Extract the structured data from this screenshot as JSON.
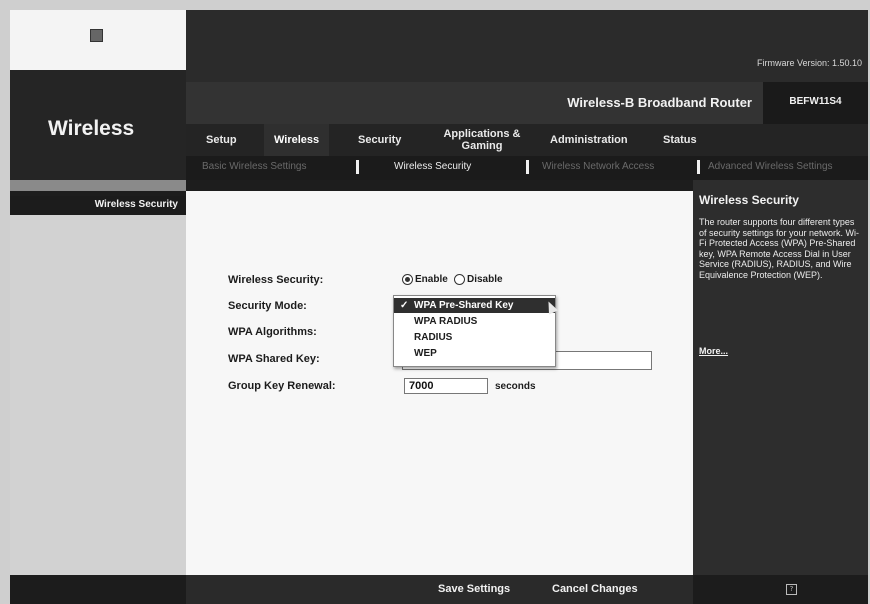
{
  "header": {
    "firmware": "Firmware Version: 1.50.10",
    "section_title": "Wireless",
    "router_name": "Wireless-B Broadband Router",
    "model": "BEFW11S4"
  },
  "tabs": [
    {
      "label": "Setup"
    },
    {
      "label": "Wireless"
    },
    {
      "label": "Security"
    },
    {
      "label": "Applications &\nGaming"
    },
    {
      "label": "Administration"
    },
    {
      "label": "Status"
    }
  ],
  "subtabs": [
    {
      "label": "Basic Wireless Settings"
    },
    {
      "label": "Wireless Security"
    },
    {
      "label": "Wireless Network Access"
    },
    {
      "label": "Advanced Wireless Settings"
    }
  ],
  "sidebar": {
    "section_label": "Wireless Security"
  },
  "form": {
    "security_label": "Wireless Security:",
    "enable_label": "Enable",
    "disable_label": "Disable",
    "mode_label": "Security Mode:",
    "algorithms_label": "WPA Algorithms:",
    "shared_key_label": "WPA Shared Key:",
    "renewal_label": "Group Key Renewal:",
    "renewal_value": "7000",
    "renewal_unit": "seconds"
  },
  "dropdown": {
    "check": "✓",
    "options": [
      {
        "label": "WPA Pre-Shared Key"
      },
      {
        "label": "WPA RADIUS"
      },
      {
        "label": "RADIUS"
      },
      {
        "label": "WEP"
      }
    ]
  },
  "help": {
    "title": "Wireless Security",
    "text": "The router supports four different types of security settings for your network. Wi-Fi Protected Access (WPA) Pre-Shared key, WPA Remote Access Dial in User Service (RADIUS), RADIUS, and Wire Equivalence Protection (WEP).",
    "more": "More..."
  },
  "buttons": {
    "save": "Save Settings",
    "cancel": "Cancel Changes"
  }
}
